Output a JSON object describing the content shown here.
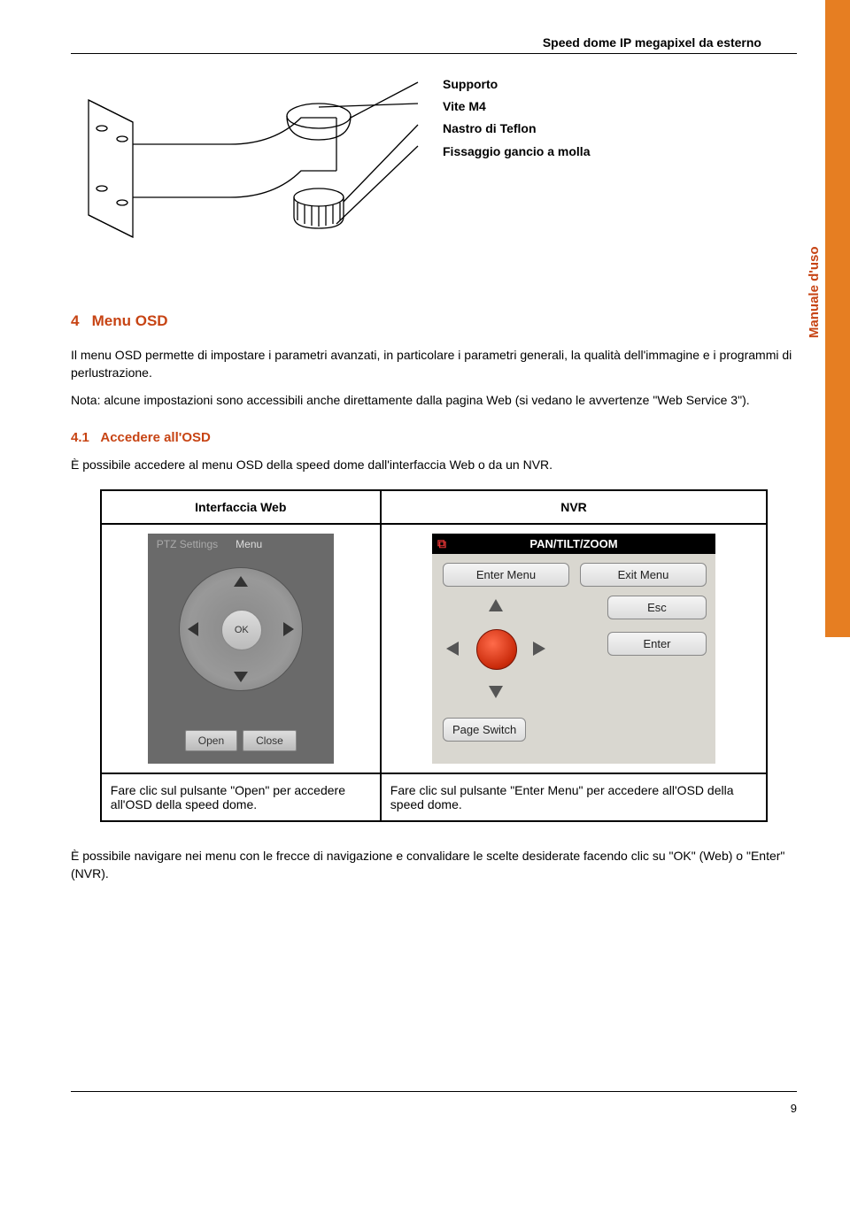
{
  "header": {
    "title": "Speed dome IP megapixel da esterno"
  },
  "side_label": "Manuale d'uso",
  "callouts": {
    "l1": "Supporto",
    "l2": "Vite M4",
    "l3": "Nastro di Teflon",
    "l4": "Fissaggio gancio a molla"
  },
  "section4": {
    "num": "4",
    "title": "Menu OSD"
  },
  "p1": "Il menu OSD permette di impostare i parametri avanzati, in particolare i parametri generali, la qualità dell'immagine e i programmi di perlustrazione.",
  "p2": "Nota: alcune impostazioni sono accessibili anche direttamente dalla pagina Web (si vedano le avvertenze \"Web Service 3\").",
  "section41": {
    "num": "4.1",
    "title": "Accedere all'OSD"
  },
  "p3": "È possibile accedere al menu OSD della speed dome dall'interfaccia Web o da un NVR.",
  "table": {
    "h1": "Interfaccia Web",
    "h2": "NVR",
    "caption1": "Fare clic sul pulsante \"Open\" per accedere all'OSD della speed dome.",
    "caption2": "Fare clic sul pulsante \"Enter Menu\" per accedere all'OSD della speed dome."
  },
  "ptz": {
    "tab1": "PTZ Settings",
    "tab2": "Menu",
    "ok": "OK",
    "open": "Open",
    "close": "Close"
  },
  "nvr": {
    "title": "PAN/TILT/ZOOM",
    "enter_menu": "Enter Menu",
    "exit_menu": "Exit Menu",
    "esc": "Esc",
    "enter": "Enter",
    "page_switch": "Page Switch"
  },
  "p4": "È possibile navigare nei menu con le frecce di navigazione e convalidare le scelte desiderate facendo clic su \"OK\" (Web) o \"Enter\" (NVR).",
  "page_number": "9"
}
